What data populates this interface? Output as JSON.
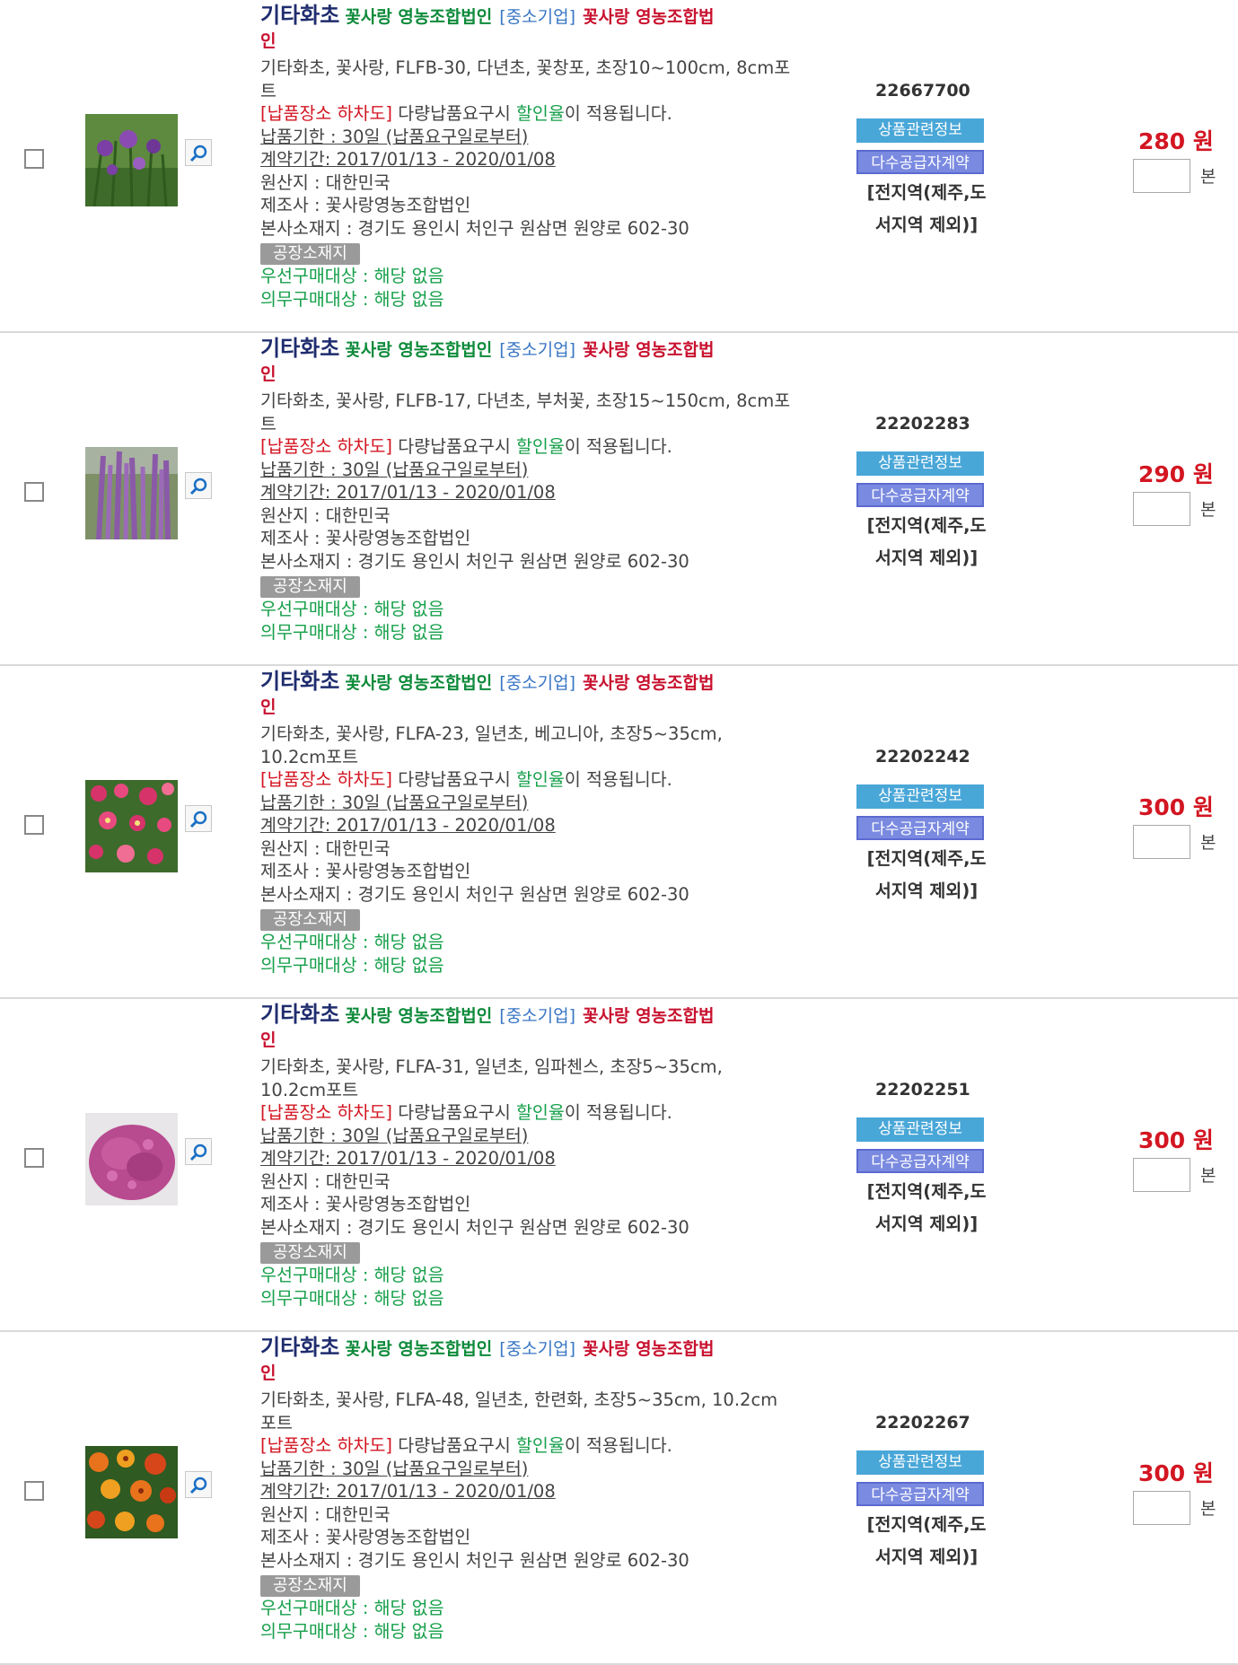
{
  "common": {
    "category": "기타화초",
    "company": "꽃사랑 영농조합법인",
    "sme_badge": "[중소기업]",
    "company_red": "꽃사랑 영농조합법",
    "company_red_wrap": "인",
    "delivery_tag": "[납품장소 하차도]",
    "delivery_text_pre": " 다량납품요구시 ",
    "discount_word": "할인율",
    "delivery_text_post": "이 적용됩니다.",
    "deadline": "납품기한 : 30일 (납품요구일로부터)",
    "contract": "계약기간: 2017/01/13 - 2020/01/08",
    "origin": "원산지 : 대한민국",
    "maker": "제조사 : 꽃사랑영농조합법인",
    "hq": "본사소재지 : 경기도 용인시 처인구 원삼면 원양로 602-30",
    "factory_tag": "공장소재지",
    "priority": "우선구매대상 : 해당 없음",
    "mandatory": "의무구매대상 : 해당 없음",
    "btn_info": "상품관련정보",
    "btn_contract": "다수공급자계약",
    "region_line1": "[전지역(제주,도",
    "region_line2": "서지역 제외)]",
    "unit": "본",
    "zoom_icon": "magnifier-icon",
    "colors": {
      "red": "#d31622",
      "green": "#17a04b",
      "navy": "#1f2c6e",
      "blue": "#3876c4"
    }
  },
  "items": [
    {
      "spec_line1": "기타화초, 꽃사랑, FLFB-30, 다년초, 꽃창포, 초장10~100cm, 8cm포",
      "spec_line2": "트",
      "code": "22667700",
      "price": "280 원",
      "image": "purple-iris-flowers"
    },
    {
      "spec_line1": "기타화초, 꽃사랑, FLFB-17, 다년초, 부처꽃, 초장15~150cm, 8cm포",
      "spec_line2": "트",
      "code": "22202283",
      "price": "290 원",
      "image": "purple-loosestrife-flowers"
    },
    {
      "spec_line1": "기타화초, 꽃사랑, FLFA-23, 일년초, 베고니아, 초장5~35cm,",
      "spec_line2": "10.2cm포트",
      "code": "22202242",
      "price": "300 원",
      "image": "pink-begonia-flowers"
    },
    {
      "spec_line1": "기타화초, 꽃사랑, FLFA-31, 일년초, 임파첸스, 초장5~35cm,",
      "spec_line2": "10.2cm포트",
      "code": "22202251",
      "price": "300 원",
      "image": "pink-impatiens-flowers"
    },
    {
      "spec_line1": "기타화초, 꽃사랑, FLFA-48, 일년초, 한련화, 초장5~35cm, 10.2cm",
      "spec_line2": "포트",
      "code": "22202267",
      "price": "300 원",
      "image": "orange-nasturtium-flowers"
    }
  ]
}
